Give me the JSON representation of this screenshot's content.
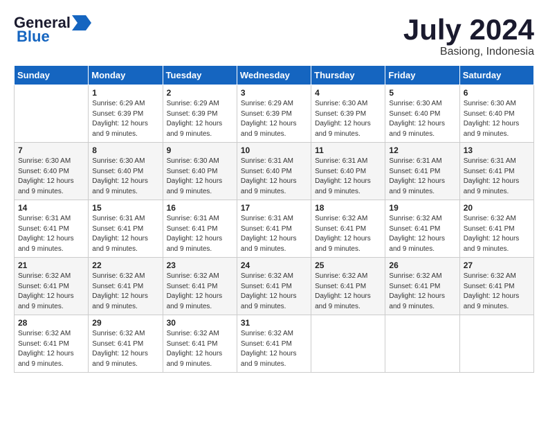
{
  "logo": {
    "line1": "General",
    "line2": "Blue",
    "arrow_unicode": "▶"
  },
  "title": "July 2024",
  "location": "Basiong, Indonesia",
  "days_of_week": [
    "Sunday",
    "Monday",
    "Tuesday",
    "Wednesday",
    "Thursday",
    "Friday",
    "Saturday"
  ],
  "weeks": [
    [
      {
        "day": "",
        "info": ""
      },
      {
        "day": "1",
        "info": "Sunrise: 6:29 AM\nSunset: 6:39 PM\nDaylight: 12 hours\nand 9 minutes."
      },
      {
        "day": "2",
        "info": "Sunrise: 6:29 AM\nSunset: 6:39 PM\nDaylight: 12 hours\nand 9 minutes."
      },
      {
        "day": "3",
        "info": "Sunrise: 6:29 AM\nSunset: 6:39 PM\nDaylight: 12 hours\nand 9 minutes."
      },
      {
        "day": "4",
        "info": "Sunrise: 6:30 AM\nSunset: 6:39 PM\nDaylight: 12 hours\nand 9 minutes."
      },
      {
        "day": "5",
        "info": "Sunrise: 6:30 AM\nSunset: 6:40 PM\nDaylight: 12 hours\nand 9 minutes."
      },
      {
        "day": "6",
        "info": "Sunrise: 6:30 AM\nSunset: 6:40 PM\nDaylight: 12 hours\nand 9 minutes."
      }
    ],
    [
      {
        "day": "7",
        "info": "Sunrise: 6:30 AM\nSunset: 6:40 PM\nDaylight: 12 hours\nand 9 minutes."
      },
      {
        "day": "8",
        "info": "Sunrise: 6:30 AM\nSunset: 6:40 PM\nDaylight: 12 hours\nand 9 minutes."
      },
      {
        "day": "9",
        "info": "Sunrise: 6:30 AM\nSunset: 6:40 PM\nDaylight: 12 hours\nand 9 minutes."
      },
      {
        "day": "10",
        "info": "Sunrise: 6:31 AM\nSunset: 6:40 PM\nDaylight: 12 hours\nand 9 minutes."
      },
      {
        "day": "11",
        "info": "Sunrise: 6:31 AM\nSunset: 6:40 PM\nDaylight: 12 hours\nand 9 minutes."
      },
      {
        "day": "12",
        "info": "Sunrise: 6:31 AM\nSunset: 6:41 PM\nDaylight: 12 hours\nand 9 minutes."
      },
      {
        "day": "13",
        "info": "Sunrise: 6:31 AM\nSunset: 6:41 PM\nDaylight: 12 hours\nand 9 minutes."
      }
    ],
    [
      {
        "day": "14",
        "info": "Sunrise: 6:31 AM\nSunset: 6:41 PM\nDaylight: 12 hours\nand 9 minutes."
      },
      {
        "day": "15",
        "info": "Sunrise: 6:31 AM\nSunset: 6:41 PM\nDaylight: 12 hours\nand 9 minutes."
      },
      {
        "day": "16",
        "info": "Sunrise: 6:31 AM\nSunset: 6:41 PM\nDaylight: 12 hours\nand 9 minutes."
      },
      {
        "day": "17",
        "info": "Sunrise: 6:31 AM\nSunset: 6:41 PM\nDaylight: 12 hours\nand 9 minutes."
      },
      {
        "day": "18",
        "info": "Sunrise: 6:32 AM\nSunset: 6:41 PM\nDaylight: 12 hours\nand 9 minutes."
      },
      {
        "day": "19",
        "info": "Sunrise: 6:32 AM\nSunset: 6:41 PM\nDaylight: 12 hours\nand 9 minutes."
      },
      {
        "day": "20",
        "info": "Sunrise: 6:32 AM\nSunset: 6:41 PM\nDaylight: 12 hours\nand 9 minutes."
      }
    ],
    [
      {
        "day": "21",
        "info": "Sunrise: 6:32 AM\nSunset: 6:41 PM\nDaylight: 12 hours\nand 9 minutes."
      },
      {
        "day": "22",
        "info": "Sunrise: 6:32 AM\nSunset: 6:41 PM\nDaylight: 12 hours\nand 9 minutes."
      },
      {
        "day": "23",
        "info": "Sunrise: 6:32 AM\nSunset: 6:41 PM\nDaylight: 12 hours\nand 9 minutes."
      },
      {
        "day": "24",
        "info": "Sunrise: 6:32 AM\nSunset: 6:41 PM\nDaylight: 12 hours\nand 9 minutes."
      },
      {
        "day": "25",
        "info": "Sunrise: 6:32 AM\nSunset: 6:41 PM\nDaylight: 12 hours\nand 9 minutes."
      },
      {
        "day": "26",
        "info": "Sunrise: 6:32 AM\nSunset: 6:41 PM\nDaylight: 12 hours\nand 9 minutes."
      },
      {
        "day": "27",
        "info": "Sunrise: 6:32 AM\nSunset: 6:41 PM\nDaylight: 12 hours\nand 9 minutes."
      }
    ],
    [
      {
        "day": "28",
        "info": "Sunrise: 6:32 AM\nSunset: 6:41 PM\nDaylight: 12 hours\nand 9 minutes."
      },
      {
        "day": "29",
        "info": "Sunrise: 6:32 AM\nSunset: 6:41 PM\nDaylight: 12 hours\nand 9 minutes."
      },
      {
        "day": "30",
        "info": "Sunrise: 6:32 AM\nSunset: 6:41 PM\nDaylight: 12 hours\nand 9 minutes."
      },
      {
        "day": "31",
        "info": "Sunrise: 6:32 AM\nSunset: 6:41 PM\nDaylight: 12 hours\nand 9 minutes."
      },
      {
        "day": "",
        "info": ""
      },
      {
        "day": "",
        "info": ""
      },
      {
        "day": "",
        "info": ""
      }
    ]
  ]
}
